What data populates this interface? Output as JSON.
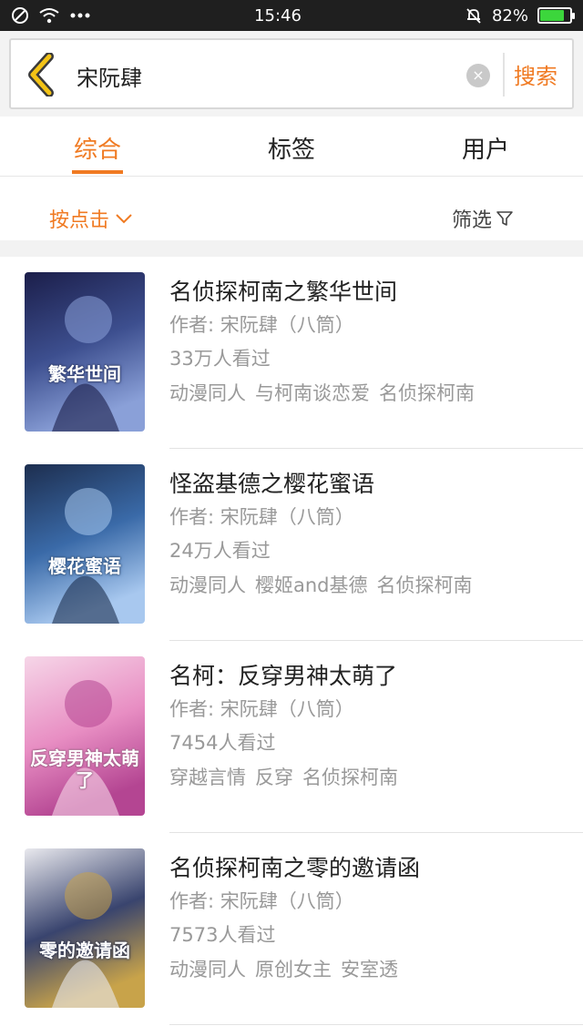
{
  "status_bar": {
    "time": "15:46",
    "battery": "82%",
    "battery_level": 0.82
  },
  "search": {
    "query": "宋阮肆",
    "clear_label": "×",
    "button_label": "搜索"
  },
  "tabs": [
    {
      "label": "综合",
      "active": true
    },
    {
      "label": "标签",
      "active": false
    },
    {
      "label": "用户",
      "active": false
    }
  ],
  "filters": {
    "sort_label": "按点击",
    "filter_label": "筛选"
  },
  "results": [
    {
      "title": "名侦探柯南之繁华世间",
      "author": "作者: 宋阮肆（八筒）",
      "views": "33万人看过",
      "tags": [
        "动漫同人",
        "与柯南谈恋爱",
        "名侦探柯南"
      ],
      "cover_text": "繁华世间",
      "cover_colors": [
        "#1b1e4a",
        "#3d4f8f",
        "#8aa0d8"
      ]
    },
    {
      "title": "怪盗基德之樱花蜜语",
      "author": "作者: 宋阮肆（八筒）",
      "views": "24万人看过",
      "tags": [
        "动漫同人",
        "樱姬and基德",
        "名侦探柯南"
      ],
      "cover_text": "樱花蜜语",
      "cover_colors": [
        "#1d2e4f",
        "#3a6aa8",
        "#a8c8ef"
      ]
    },
    {
      "title": "名柯：反穿男神太萌了",
      "author": "作者: 宋阮肆（八筒）",
      "views": "7454人看过",
      "tags": [
        "穿越言情",
        "反穿",
        "名侦探柯南"
      ],
      "cover_text": "反穿男神太萌了",
      "cover_colors": [
        "#f6d6e8",
        "#e88ec3",
        "#b44592"
      ]
    },
    {
      "title": "名侦探柯南之零的邀请函",
      "author": "作者: 宋阮肆（八筒）",
      "views": "7573人看过",
      "tags": [
        "动漫同人",
        "原创女主",
        "安室透"
      ],
      "cover_text": "零的邀请函",
      "cover_colors": [
        "#e9e9ee",
        "#39446e",
        "#c8a34a"
      ]
    }
  ]
}
